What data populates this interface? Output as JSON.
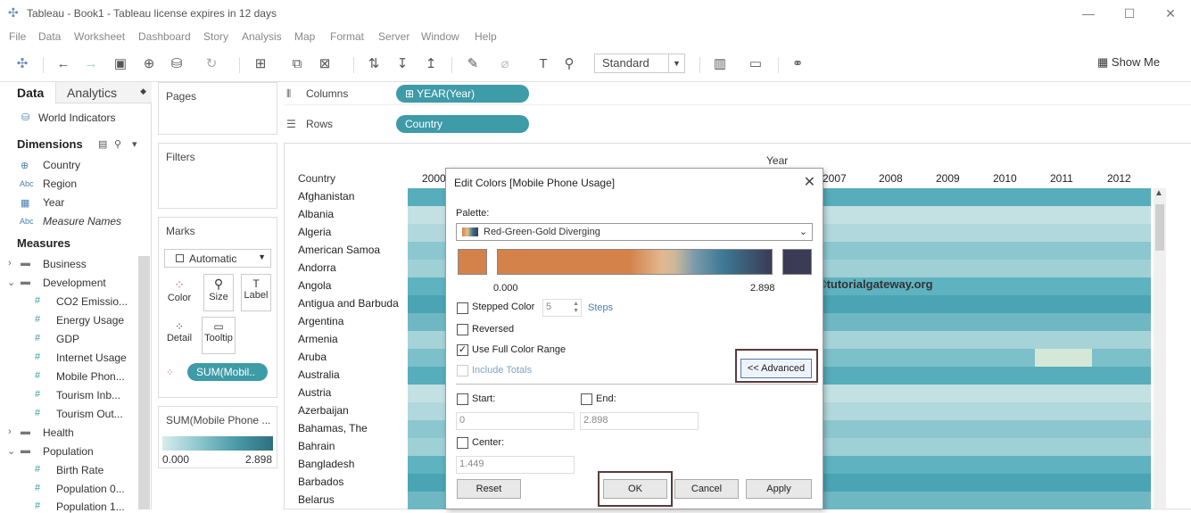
{
  "window": {
    "title": "Tableau - Book1 - Tableau license expires in 12 days",
    "min": "—",
    "max": "☐",
    "close": "✕"
  },
  "menu": [
    "File",
    "Data",
    "Worksheet",
    "Dashboard",
    "Story",
    "Analysis",
    "Map",
    "Format",
    "Server",
    "Window",
    "Help"
  ],
  "toolbar": {
    "fit": "Standard",
    "show_me": "Show Me"
  },
  "left": {
    "tab_data": "Data",
    "tab_analytics": "Analytics",
    "source": "World Indicators",
    "dimensions_label": "Dimensions",
    "dimensions": [
      {
        "icon": "globe",
        "label": "Country"
      },
      {
        "icon": "Abc",
        "label": "Region"
      },
      {
        "icon": "calendar",
        "label": "Year"
      },
      {
        "icon": "Abc",
        "label": "Measure Names"
      }
    ],
    "measures_label": "Measures",
    "folders": [
      {
        "label": "Business"
      },
      {
        "label": "Development"
      }
    ],
    "measures_dev": [
      "CO2 Emissio...",
      "Energy Usage",
      "GDP",
      "Internet Usage",
      "Mobile Phon...",
      "Tourism Inb...",
      "Tourism Out..."
    ],
    "folders2": [
      {
        "label": "Health"
      },
      {
        "label": "Population"
      }
    ],
    "measures_pop": [
      "Birth Rate",
      "Population 0...",
      "Population 1..."
    ]
  },
  "cards": {
    "pages": "Pages",
    "filters": "Filters",
    "marks": "Marks",
    "mark_type": "Automatic",
    "mark_btns": [
      "Color",
      "Size",
      "Label",
      "Detail",
      "Tooltip"
    ],
    "sum_pill": "SUM(Mobil..",
    "legend_title": "SUM(Mobile Phone ...",
    "legend_min": "0.000",
    "legend_max": "2.898"
  },
  "shelves": {
    "columns_label": "Columns",
    "columns_pill": "YEAR(Year)",
    "rows_label": "Rows",
    "rows_pill": "Country"
  },
  "view": {
    "year_header": "Year",
    "country_header": "Country",
    "years": [
      "2000",
      "2007",
      "2008",
      "2009",
      "2010",
      "2011",
      "2012"
    ],
    "countries": [
      "Afghanistan",
      "Albania",
      "Algeria",
      "American Samoa",
      "Andorra",
      "Angola",
      "Antigua and Barbuda",
      "Argentina",
      "Armenia",
      "Aruba",
      "Australia",
      "Austria",
      "Azerbaijan",
      "Bahamas, The",
      "Bahrain",
      "Bangladesh",
      "Barbados",
      "Belarus"
    ]
  },
  "dialog": {
    "title": "Edit Colors [Mobile Phone Usage]",
    "palette_label": "Palette:",
    "palette": "Red-Green-Gold Diverging",
    "range_min": "0.000",
    "range_max": "2.898",
    "stepped": "Stepped Color",
    "steps_value": "5",
    "steps_label": "Steps",
    "reversed": "Reversed",
    "full_range": "Use Full Color Range",
    "include_totals": "Include Totals",
    "advanced": "<< Advanced",
    "start_label": "Start:",
    "start_value": "0",
    "end_label": "End:",
    "end_value": "2.898",
    "center_label": "Center:",
    "center_value": "1.449",
    "reset": "Reset",
    "ok": "OK",
    "cancel": "Cancel",
    "apply": "Apply"
  },
  "watermark": "©tutorialgateway.org",
  "colors": {
    "accent": "#3e9ba8",
    "heat_dark": "#3d9cb0",
    "heat_light": "#c8e3e4",
    "palette_orange": "#d4814a",
    "palette_dark": "#3b3b55"
  }
}
